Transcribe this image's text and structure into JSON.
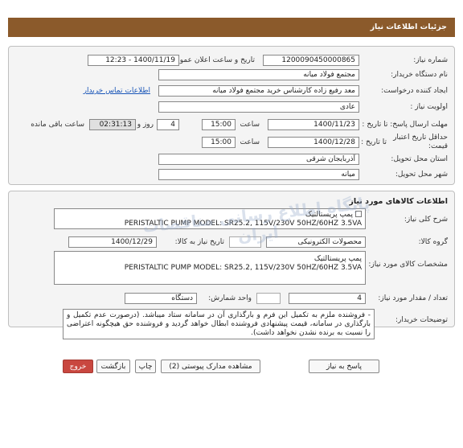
{
  "header": {
    "title": "جزئیات اطلاعات نیاز"
  },
  "request": {
    "number_label": "شماره نیاز:",
    "number": "1200090450000865",
    "announce_label": "تاریخ و ساعت اعلان عمومی:",
    "announce": "1400/11/19 - 12:23",
    "buyer_org_label": "نام دستگاه خریدار:",
    "buyer_org": "مجتمع فولاد میانه",
    "creator_label": "ایجاد کننده درخواست:",
    "creator": "معد رفیع زاده کارشناس خرید مجتمع فولاد میانه",
    "contact_link": "اطلاعات تماس خریدار",
    "priority_label": "اولویت نیاز :",
    "priority": "عادی",
    "deadline_label": "مهلت ارسال پاسخ: تا تاریخ :",
    "deadline_date": "1400/11/23",
    "time_label": "ساعت",
    "deadline_time": "15:00",
    "days": "4",
    "days_label": "روز و",
    "remaining": "02:31:13",
    "remaining_label": "ساعت باقی مانده",
    "validity_label": "حداقل تاریخ اعتبار قیمت:",
    "validity_to": "تا تاریخ :",
    "validity_date": "1400/12/28",
    "validity_time": "15:00",
    "province_label": "استان محل تحویل:",
    "province": "آذربایجان شرقی",
    "city_label": "شهر محل تحویل:",
    "city": "میانه"
  },
  "goods": {
    "title": "اطلاعات کالاهای مورد نیاز",
    "desc_label": "شرح کلی نیاز:",
    "desc_line1": "پمپ پریستالتیک",
    "desc_line2": "PERISTALTIC PUMP       MODEL: SR25.2, 115V/230V 50HZ/60HZ 3.5VA",
    "group_label": "گروه کالا:",
    "group": "محصولات الکترونیکی",
    "need_date_label": "تاریخ نیاز به کالا:",
    "need_date": "1400/12/29",
    "spec_label": "مشخصات کالای مورد نیاز:",
    "spec_line1": "پمپ پریستالتیک",
    "spec_line2": "PERISTALTIC PUMP       MODEL: SR25.2, 115V/230V 50HZ/60HZ 3.5VA",
    "qty_label": "تعداد / مقدار مورد نیاز:",
    "qty": "4",
    "unit_label": "واحد شمارش:",
    "unit": "دستگاه",
    "notes_label": "توضیحات خریدار:",
    "notes": "- فروشنده ملزم به تکمیل این فرم و بارگذاری آن در سامانه ستاد میباشد. (درصورت عدم تکمیل و بارگذاری در سامانه، قیمت پیشنهادی فروشنده ابطال خواهد گردید و فروشنده حق هیچگونه اعتراضی را نسبت به برنده نشدن نخواهد داشت)."
  },
  "watermark": "پایگاه اطلاع رسانی مناقصات ایران",
  "buttons": {
    "reply": "پاسخ به نیاز",
    "attachments": "مشاهده مدارک پیوستی (2)",
    "print": "چاپ",
    "back": "بازگشت",
    "exit": "خروج"
  }
}
